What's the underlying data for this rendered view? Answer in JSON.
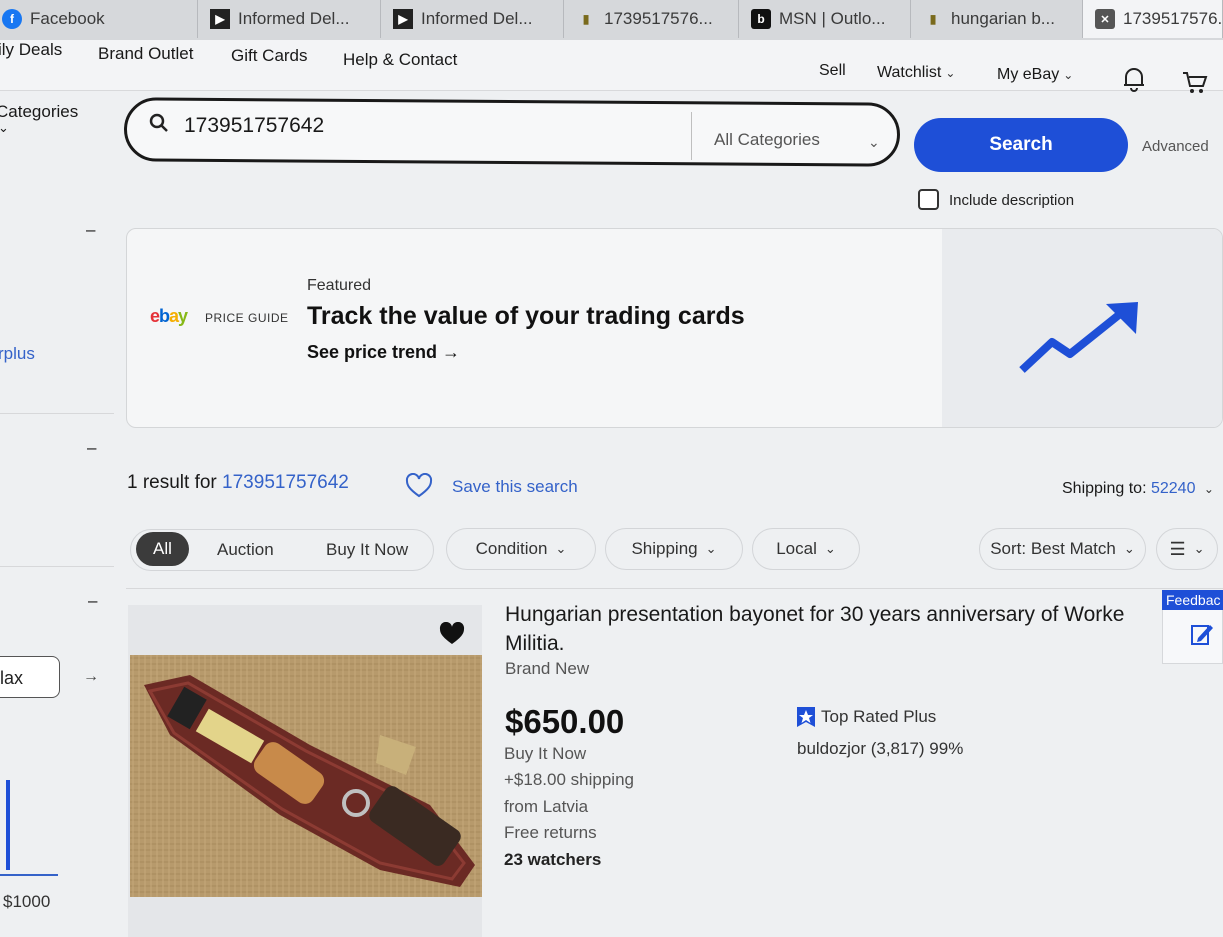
{
  "browser_tabs": [
    {
      "label": "Facebook",
      "icon": "facebook-icon"
    },
    {
      "label": "Informed Del...",
      "icon": "usps-icon"
    },
    {
      "label": "Informed Del...",
      "icon": "usps-icon"
    },
    {
      "label": "1739517576...",
      "icon": "ebay-favicon-icon"
    },
    {
      "label": "MSN | Outlo...",
      "icon": "outlook-icon"
    },
    {
      "label": "hungarian b...",
      "icon": "ebay-favicon-icon"
    },
    {
      "label": "1739517576..",
      "icon": "close-icon"
    }
  ],
  "topnav": {
    "daily_deals": "ily Deals",
    "brand_outlet": "Brand Outlet",
    "gift_cards": "Gift Cards",
    "help_contact": "Help & Contact",
    "sell": "Sell",
    "watchlist": "Watchlist",
    "my_ebay": "My eBay"
  },
  "sidebar": {
    "categories": "Categories",
    "collapse_1": "–",
    "plus": "rplus",
    "collapse_2": "–",
    "collapse_3": "–",
    "max_value": "lax",
    "price_max_label": "$1000"
  },
  "search": {
    "query": "173951757642",
    "category": "All Categories",
    "button": "Search",
    "advanced": "Advanced",
    "include_description": "Include description"
  },
  "banner": {
    "logo": "ebay",
    "price_guide": "PRICE GUIDE",
    "featured": "Featured",
    "title": "Track the value of your trading cards",
    "link": "See price trend →"
  },
  "results": {
    "count_prefix": "1 result for",
    "query": "173951757642",
    "save_search": "Save this search",
    "shipping_to_label": "Shipping to:",
    "zip": "52240"
  },
  "filters": {
    "all": "All",
    "auction": "Auction",
    "buy_it_now": "Buy It Now",
    "condition": "Condition",
    "shipping": "Shipping",
    "local": "Local",
    "sort": "Sort: Best Match"
  },
  "listing": {
    "title": "Hungarian presentation bayonet for 30 years anniversary of Worke Militia.",
    "condition": "Brand New",
    "price": "$650.00",
    "buy_format": "Buy It Now",
    "shipping": "+$18.00 shipping",
    "location": "from Latvia",
    "returns": "Free returns",
    "watchers": "23 watchers",
    "badge": "Top Rated Plus",
    "seller": "buldozjor (3,817) 99%"
  },
  "feedback": {
    "label": "Feedbac"
  },
  "colors": {
    "accent": "#1e4fd7",
    "link": "#3462c9"
  }
}
